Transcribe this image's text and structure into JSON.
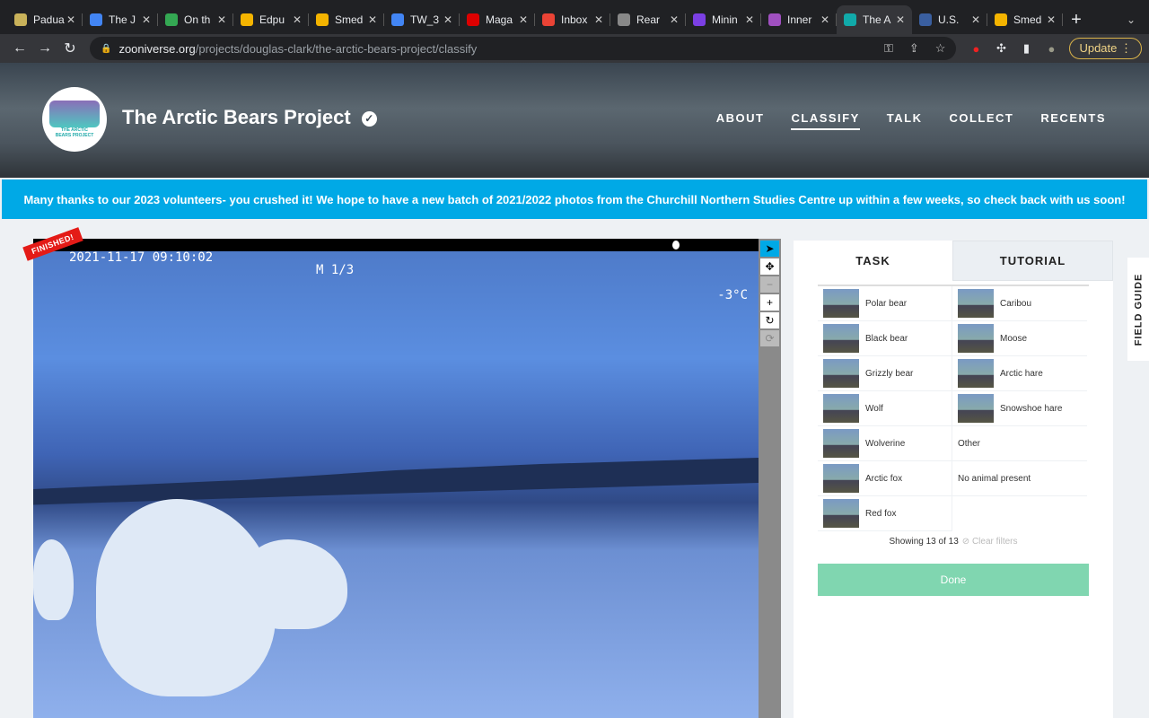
{
  "browser": {
    "tabs": [
      {
        "title": "Padua",
        "color": "#c9b25a"
      },
      {
        "title": "The J",
        "color": "#4285f4"
      },
      {
        "title": "On th",
        "color": "#34a853"
      },
      {
        "title": "Edpu",
        "color": "#f4b400"
      },
      {
        "title": "Smed",
        "color": "#f4b400"
      },
      {
        "title": "TW_3",
        "color": "#4285f4"
      },
      {
        "title": "Maga",
        "color": "#d00"
      },
      {
        "title": "Inbox",
        "color": "#ea4335"
      },
      {
        "title": "Rear",
        "color": "#888"
      },
      {
        "title": "Minin",
        "color": "#7b3fe4"
      },
      {
        "title": "Inner",
        "color": "#a050c0"
      },
      {
        "title": "The A",
        "color": "#1aa",
        "active": true
      },
      {
        "title": "U.S.",
        "color": "#3a5fa0"
      },
      {
        "title": "Smed",
        "color": "#f4b400"
      }
    ],
    "url_domain": "zooniverse.org",
    "url_path": "/projects/douglas-clark/the-arctic-bears-project/classify",
    "update_label": "Update"
  },
  "project": {
    "title": "The Arctic Bears Project",
    "logo_text": "THE ARCTIC BEARS PROJECT",
    "nav": [
      "ABOUT",
      "CLASSIFY",
      "TALK",
      "COLLECT",
      "RECENTS"
    ]
  },
  "banner": "Many thanks to our 2023 volunteers- you crushed it! We hope to have a new batch of 2021/2022 photos from the Churchill Northern Studies Centre up within a few weeks, so check back with us soon!",
  "subject": {
    "timestamp": "2021-11-17 09:10:02",
    "mode": "M 1/3",
    "temperature": "-3°C",
    "badge": "FINISHED!"
  },
  "panel": {
    "tabs": [
      "TASK",
      "TUTORIAL"
    ],
    "choices_left": [
      "Polar bear",
      "Black bear",
      "Grizzly bear",
      "Wolf",
      "Wolverine",
      "Arctic fox",
      "Red fox"
    ],
    "choices_right": [
      "Caribou",
      "Moose",
      "Arctic hare",
      "Snowshoe hare",
      "Other",
      "No animal present"
    ],
    "showing": "Showing 13 of 13",
    "clear_filters": "Clear filters",
    "done": "Done"
  },
  "field_guide": "FIELD GUIDE"
}
